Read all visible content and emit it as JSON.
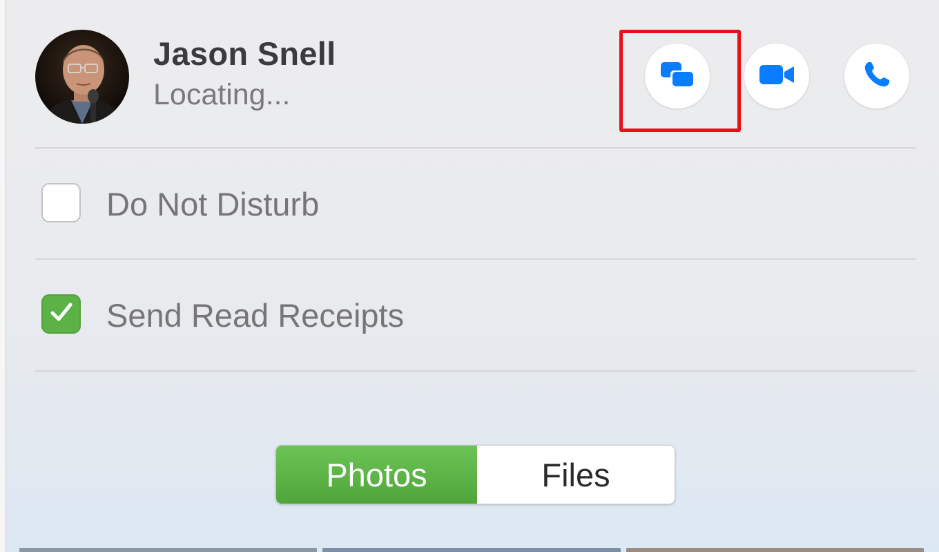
{
  "contact": {
    "name": "Jason Snell",
    "status": "Locating..."
  },
  "actions": {
    "message_icon": "message-bubbles-icon",
    "video_icon": "video-camera-icon",
    "phone_icon": "phone-icon"
  },
  "options": {
    "do_not_disturb": {
      "label": "Do Not Disturb",
      "checked": false
    },
    "send_read_receipts": {
      "label": "Send Read Receipts",
      "checked": true
    }
  },
  "tabs": {
    "photos": "Photos",
    "files": "Files",
    "selected": "Photos"
  },
  "colors": {
    "accent_blue": "#0a7cff",
    "check_green": "#5cb246",
    "highlight_red": "#e8111a"
  }
}
